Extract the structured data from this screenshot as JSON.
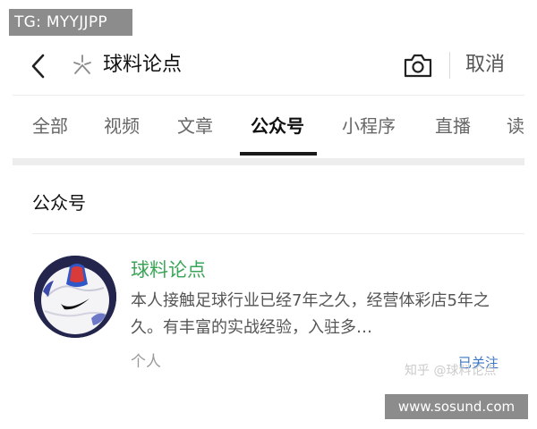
{
  "watermark_top": "TG: MYYJJPP",
  "search": {
    "query": "球料论点",
    "cancel_label": "取消"
  },
  "tabs": [
    {
      "label": "全部"
    },
    {
      "label": "视频"
    },
    {
      "label": "文章"
    },
    {
      "label": "公众号",
      "active": true
    },
    {
      "label": "小程序"
    },
    {
      "label": "直播"
    },
    {
      "label": "读"
    }
  ],
  "section": {
    "title": "公众号"
  },
  "result": {
    "name": "球料论点",
    "description": "本人接触足球行业已经7年之久，经营体彩店5年之久。有丰富的实战经验，入驻多…",
    "type": "个人",
    "follow_status": "已关注"
  },
  "zhihu_watermark": "知乎 @球料论点",
  "watermark_bottom": "www.sosund.com",
  "colors": {
    "accent_green": "#3aa557",
    "link_blue": "#3a76c4"
  }
}
